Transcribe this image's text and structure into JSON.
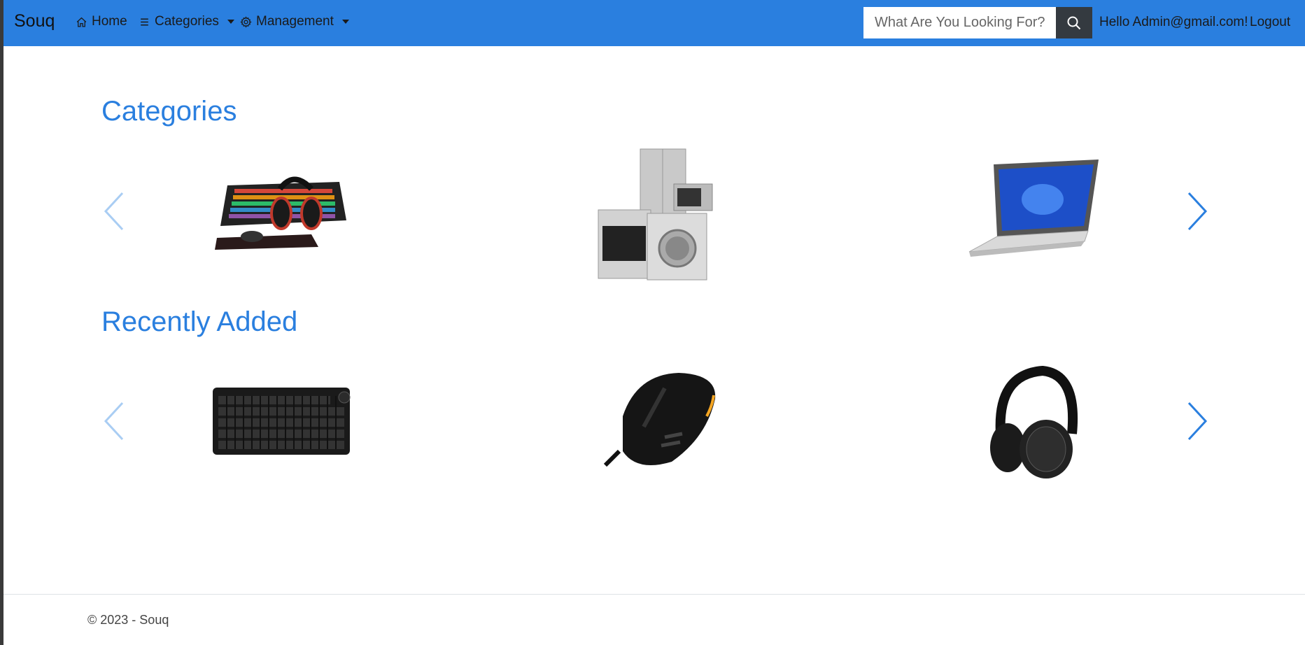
{
  "navbar": {
    "brand": "Souq",
    "home": "Home",
    "categories": "Categories",
    "management": "Management",
    "search_placeholder": "What Are You Looking For?",
    "greeting": "Hello Admin@gmail.com!",
    "logout": "Logout",
    "bg_color": "#2a7fdf"
  },
  "sections": {
    "categories_title": "Categories",
    "recent_title": "Recently Added"
  },
  "categories_items": [
    {
      "icon": "gaming-keyboard-headset-image"
    },
    {
      "icon": "home-appliances-image"
    },
    {
      "icon": "laptop-image"
    }
  ],
  "recent_items": [
    {
      "icon": "keyboard-image"
    },
    {
      "icon": "mouse-image"
    },
    {
      "icon": "headphones-image"
    }
  ],
  "footer": {
    "text": "© 2023 - Souq"
  },
  "colors": {
    "accent": "#2a7fdf",
    "search_button": "#343a40"
  }
}
